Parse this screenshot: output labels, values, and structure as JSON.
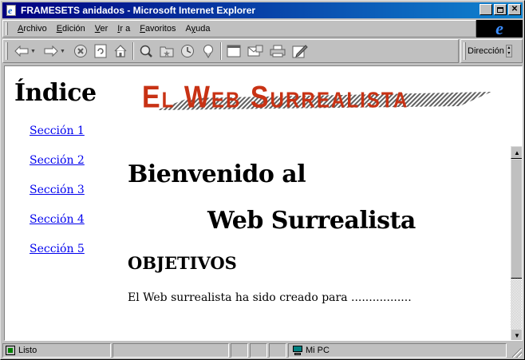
{
  "window": {
    "title": "FRAMESETS anidados - Microsoft Internet Explorer"
  },
  "menu": {
    "items": [
      {
        "label": "Archivo",
        "accel": "A"
      },
      {
        "label": "Edición",
        "accel": "E"
      },
      {
        "label": "Ver",
        "accel": "V"
      },
      {
        "label": "Ir a",
        "accel": "I"
      },
      {
        "label": "Favoritos",
        "accel": "F"
      },
      {
        "label": "Ayuda",
        "accel": "y"
      }
    ]
  },
  "toolbar": {
    "buttons": [
      "back-icon",
      "forward-icon",
      "stop-icon",
      "refresh-icon",
      "home-icon",
      "search-icon",
      "favorites-icon",
      "history-icon",
      "channels-icon",
      "fullscreen-icon",
      "mail-icon",
      "print-icon",
      "edit-icon"
    ],
    "address_label": "Dirección"
  },
  "left_frame": {
    "title": "Índice",
    "links": [
      "Sección 1",
      "Sección 2",
      "Sección 3",
      "Sección 4",
      "Sección 5"
    ]
  },
  "top_frame": {
    "banner_text": "El Web Surrealista",
    "banner_color": "#c83214"
  },
  "main_frame": {
    "heading_line1": "Bienvenido al",
    "heading_line2": "Web Surrealista",
    "subheading": "OBJETIVOS",
    "paragraph": "El Web surrealista ha sido creado para ................."
  },
  "status": {
    "text": "Listo",
    "zone": "Mi PC"
  }
}
